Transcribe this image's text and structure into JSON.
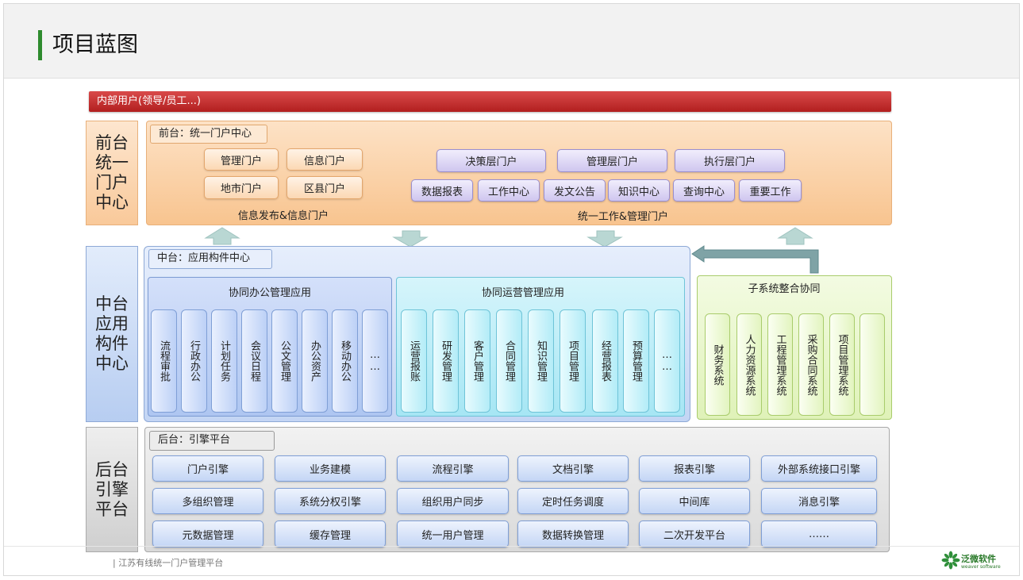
{
  "page": {
    "title": "项目蓝图"
  },
  "banner": "内部用户(领导/员工...)",
  "layers": {
    "front": "前台统一门户中心",
    "mid": "中台应用构件中心",
    "back": "后台引擎平台"
  },
  "front": {
    "tag": "前台：统一门户中心",
    "left_buttons": [
      "管理门户",
      "信息门户",
      "地市门户",
      "区县门户"
    ],
    "left_caption": "信息发布&信息门户",
    "top_buttons": [
      "决策层门户",
      "管理层门户",
      "执行层门户"
    ],
    "bottom_buttons": [
      "数据报表",
      "工作中心",
      "发文公告",
      "知识中心",
      "查询中心",
      "重要工作"
    ],
    "right_caption": "统一工作&管理门户"
  },
  "mid": {
    "tag": "中台：应用构件中心",
    "office": {
      "title": "协同办公管理应用",
      "items": [
        "流程审批",
        "行政办公",
        "计划任务",
        "会议日程",
        "公文管理",
        "办公资产",
        "移动办公",
        "……"
      ]
    },
    "ops": {
      "title": "协同运营管理应用",
      "items": [
        "运营报账",
        "研发管理",
        "客户管理",
        "合同管理",
        "知识管理",
        "项目管理",
        "经营报表",
        "预算管理",
        "……"
      ]
    }
  },
  "subsystems": {
    "title": "子系统整合协同",
    "items": [
      "财务系统",
      "人力资源系统",
      "工程管理系统",
      "采购合同系统",
      "项目管理系统",
      ""
    ]
  },
  "back": {
    "tag": "后台：引擎平台",
    "rows": [
      [
        "门户引擎",
        "业务建模",
        "流程引擎",
        "文档引擎",
        "报表引擎",
        "外部系统接口引擎"
      ],
      [
        "多组织管理",
        "系统分权引擎",
        "组织用户同步",
        "定时任务调度",
        "中间库",
        "消息引擎"
      ],
      [
        "元数据管理",
        "缓存管理",
        "统一用户管理",
        "数据转换管理",
        "二次开发平台",
        "……"
      ]
    ]
  },
  "footer": {
    "text": "| 江苏有线统一门户管理平台",
    "logo": "泛微软件",
    "logo_sub": "weaver software"
  }
}
